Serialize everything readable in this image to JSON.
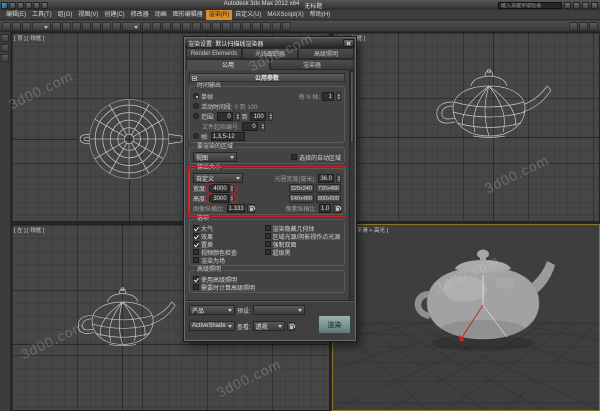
{
  "window": {
    "title": "Autodesk 3ds Max 2012 x64",
    "document": "无标题",
    "search_placeholder": "键入关键字或短语"
  },
  "colors": {
    "annotation_red": "#cc2222",
    "menu_highlight_orange": "#d98f2e",
    "render_button_teal": "#7d9694"
  },
  "menubar": {
    "items": [
      "编辑(E)",
      "工具(T)",
      "组(G)",
      "视图(V)",
      "创建(C)",
      "修改器",
      "动画",
      "图形编辑器",
      "渲染(R)",
      "自定义(U)",
      "MAXScript(X)",
      "帮助(H)"
    ],
    "highlighted": "渲染(R)"
  },
  "toolbar": {
    "icons": [
      "select-link-icon",
      "unlink-selection-icon",
      "bind-spacewarp-icon",
      "selection-filter-dropdown",
      "select-object-icon",
      "select-by-name-icon",
      "rect-selection-region-icon",
      "window-crossing-icon",
      "select-move-icon",
      "select-rotate-icon",
      "select-scale-icon",
      "reference-coord-dropdown",
      "use-pivot-center-icon",
      "select-manipulate-icon",
      "keyboard-override-icon",
      "snap-3d-icon",
      "angle-snap-icon",
      "percent-snap-icon",
      "spinner-snap-icon",
      "edit-named-selections-icon",
      "mirror-icon",
      "align-icon",
      "layer-manager-icon",
      "graphite-ribbon-icon",
      "curve-editor-icon",
      "schematic-view-icon",
      "material-editor-icon",
      "render-setup-icon",
      "rendered-frame-icon",
      "render-production-icon"
    ]
  },
  "viewports": {
    "top": "[ 顶 ] [ 线框 ]",
    "front": "[ 前 ] [ 线框 ]",
    "left": "[ 左 ] [ 线框 ]",
    "perspective": "[ 透视 ] [ 平滑 + 高光 ]"
  },
  "watermark": {
    "text": "3d00.com"
  },
  "dialog": {
    "title": "渲染设置: 默认扫描线渲染器",
    "tabs_row1": [
      "Render Elements",
      "光线跟踪器",
      "高级照明"
    ],
    "tabs_row2": [
      "公用",
      "渲染器"
    ],
    "rollout": "公用参数",
    "time": {
      "legend": "时间输出",
      "single": "单帧",
      "every_nth": "每 N 帧:",
      "every_nth_value": "1",
      "active": "活动时间段:",
      "active_range": "0 到 100",
      "range": "范围:",
      "range_from": "0",
      "to": "到",
      "range_to": "100",
      "file_label": "文件起始编号:",
      "file_value": "0",
      "frames": "帧:",
      "frames_value": "1,3,5-12"
    },
    "area": {
      "legend": "要渲染的区域",
      "view_value": "视图",
      "auto_region": "选择的自动区域"
    },
    "out": {
      "legend": "输出大小",
      "preset": "自定义",
      "aperture_label": "光圈宽度(毫米):",
      "aperture_value": "36.0",
      "width_label": "宽度:",
      "width_value": "4000",
      "height_label": "高度:",
      "height_value": "3000",
      "btns": [
        "320x240",
        "720x486",
        "640x480",
        "800x600"
      ],
      "img_aspect_label": "图像纵横比:",
      "img_aspect_value": "1.333",
      "pix_aspect_label": "像素纵横比:",
      "pix_aspect_value": "1.0"
    },
    "options": {
      "legend": "选项",
      "left": [
        {
          "label": "大气",
          "checked": true
        },
        {
          "label": "效果",
          "checked": true
        },
        {
          "label": "置换",
          "checked": true
        },
        {
          "label": "视频颜色检查",
          "checked": false
        },
        {
          "label": "渲染为场",
          "checked": false
        }
      ],
      "right": [
        {
          "label": "渲染隐藏几何体",
          "checked": false
        },
        {
          "label": "区域光源/阴影视作点光源",
          "checked": false
        },
        {
          "label": "强制双面",
          "checked": false
        },
        {
          "label": "超级黑",
          "checked": false
        }
      ]
    },
    "adv": {
      "legend": "高级照明",
      "items": [
        {
          "label": "使用高级照明",
          "checked": true
        },
        {
          "label": "需要时计算高级照明",
          "checked": false
        }
      ]
    },
    "footer": {
      "production": "产品",
      "preset_label": "预设:",
      "activeshade": "ActiveShade",
      "view_label": "查看:",
      "view_value": "透视",
      "render": "渲染"
    }
  }
}
